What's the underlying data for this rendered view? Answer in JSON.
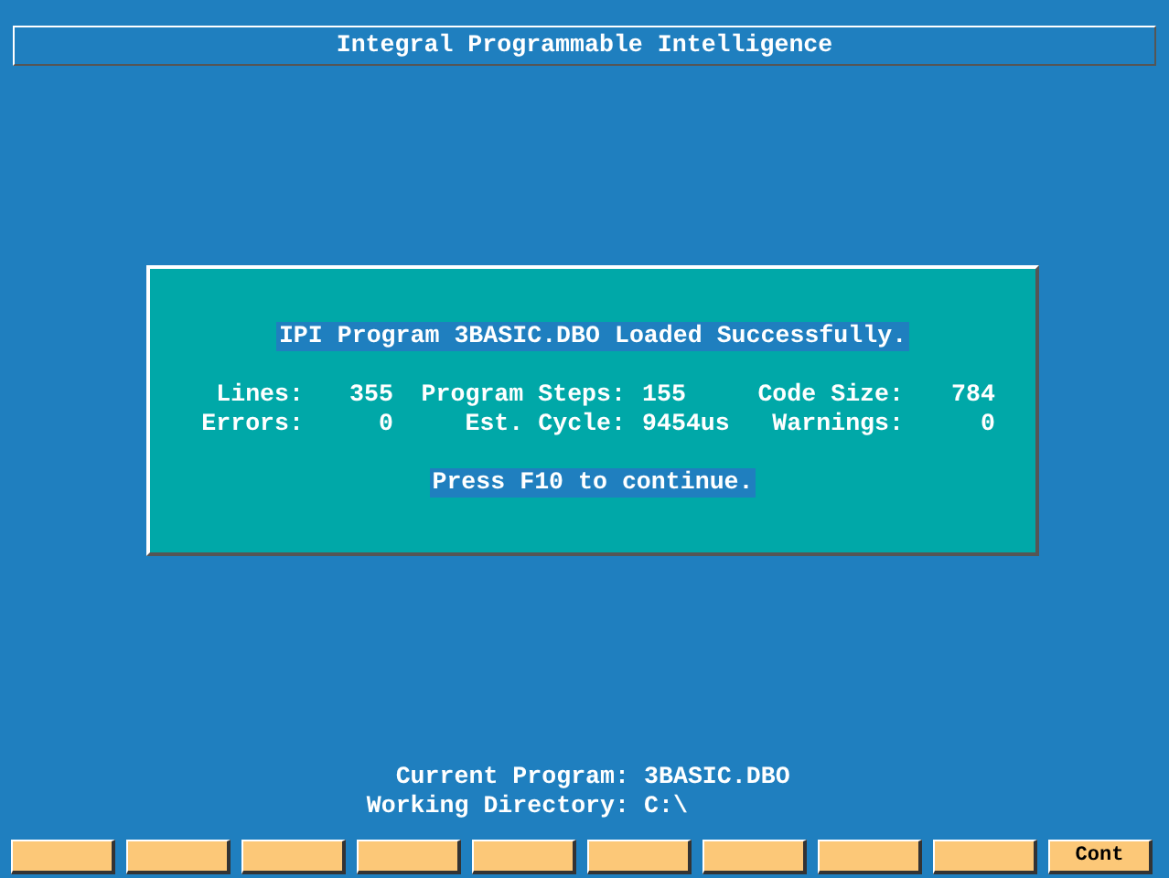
{
  "title": "Integral Programmable Intelligence",
  "dialog": {
    "heading": "IPI Program 3BASIC.DBO Loaded Successfully.",
    "stats": [
      {
        "label": "Lines:",
        "value": "355"
      },
      {
        "label": "Program Steps:",
        "value": "155"
      },
      {
        "label": "Code Size:",
        "value": "784"
      },
      {
        "label": "Errors:",
        "value": "0"
      },
      {
        "label": "Est. Cycle:",
        "value": "9454us"
      },
      {
        "label": "Warnings:",
        "value": "0"
      }
    ],
    "prompt": "Press F10 to continue."
  },
  "status": [
    {
      "label": "Current Program:",
      "value": "3BASIC.DBO"
    },
    {
      "label": "Working Directory:",
      "value": "C:\\"
    }
  ],
  "function_keys": [
    {
      "kind": "blank"
    },
    {
      "kind": "blank"
    },
    {
      "kind": "blank"
    },
    {
      "kind": "blank"
    },
    {
      "kind": "blank"
    },
    {
      "kind": "blank"
    },
    {
      "kind": "blank"
    },
    {
      "kind": "blank"
    },
    {
      "kind": "blank"
    },
    {
      "kind": "labeled",
      "label": "Cont"
    }
  ]
}
